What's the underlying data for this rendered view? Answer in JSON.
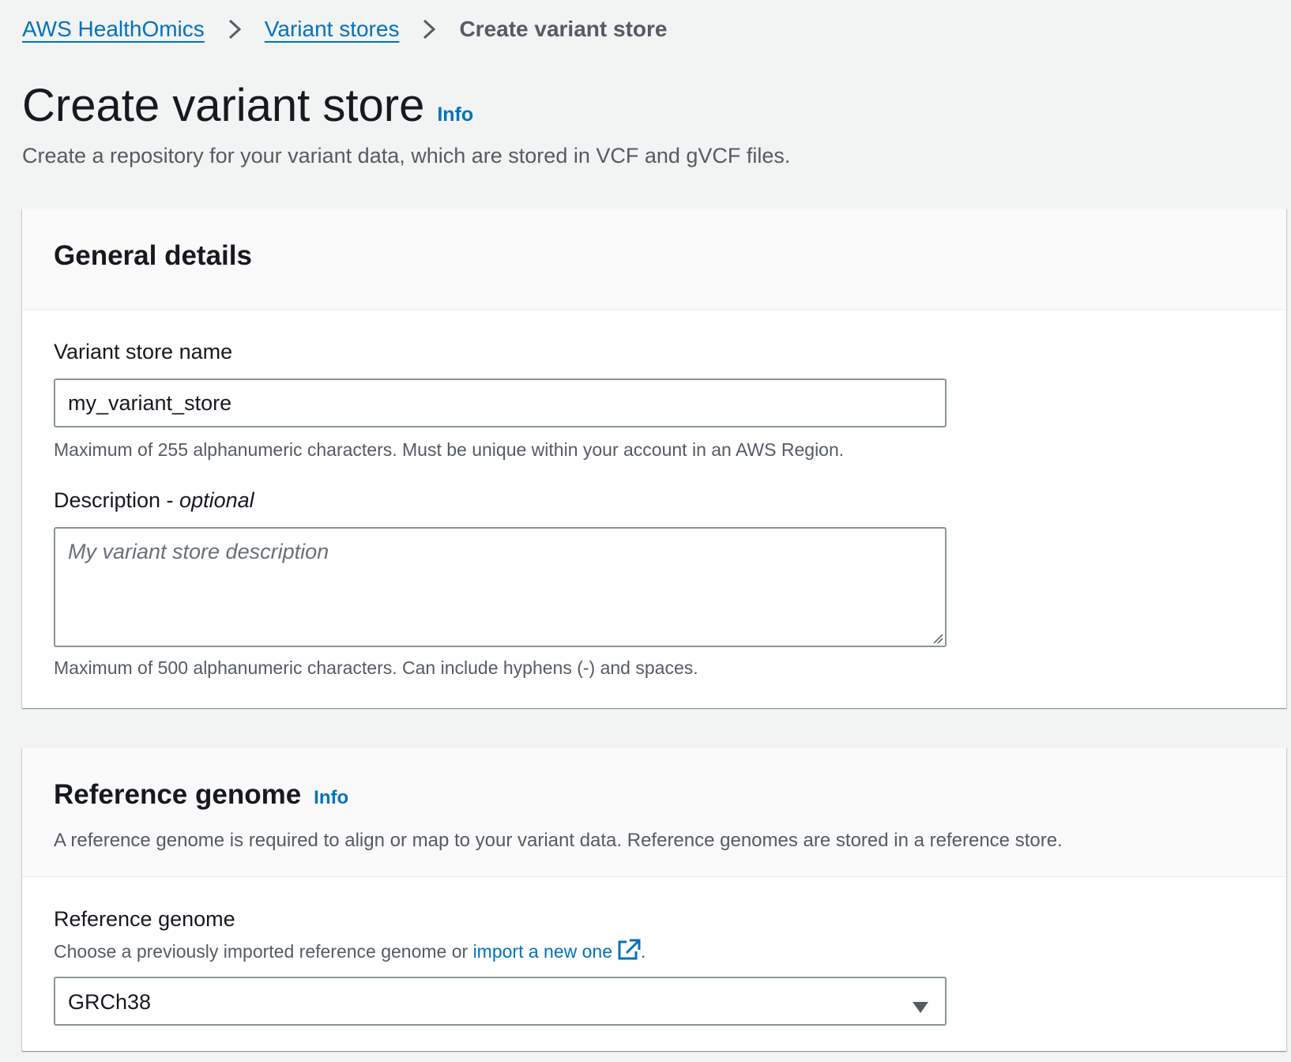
{
  "breadcrumb": {
    "items": [
      "AWS HealthOmics",
      "Variant stores"
    ],
    "current": "Create variant store"
  },
  "header": {
    "title": "Create variant store",
    "info_label": "Info",
    "description": "Create a repository for your variant data, which are stored in VCF and gVCF files."
  },
  "general_details": {
    "title": "General details",
    "name_label": "Variant store name",
    "name_value": "my_variant_store",
    "name_hint": "Maximum of 255 alphanumeric characters. Must be unique within your account in an AWS Region.",
    "description_label": "Description - ",
    "description_optional": "optional",
    "description_placeholder": "My variant store description",
    "description_hint": "Maximum of 500 alphanumeric characters. Can include hyphens (-) and spaces."
  },
  "reference_genome": {
    "title": "Reference genome",
    "info_label": "Info",
    "subtitle": "A reference genome is required to align or map to your variant data. Reference genomes are stored in a reference store.",
    "field_label": "Reference genome",
    "hint_prefix": "Choose a previously imported reference genome or ",
    "hint_link": "import a new one",
    "hint_suffix": ".",
    "selected_value": "GRCh38"
  },
  "colors": {
    "link": "#0073bb",
    "text": "#16191f",
    "muted": "#545b64",
    "background": "#f2f3f3"
  },
  "icons": [
    "chevron-right-icon",
    "external-link-icon",
    "caret-down-icon",
    "resize-grip-icon"
  ]
}
